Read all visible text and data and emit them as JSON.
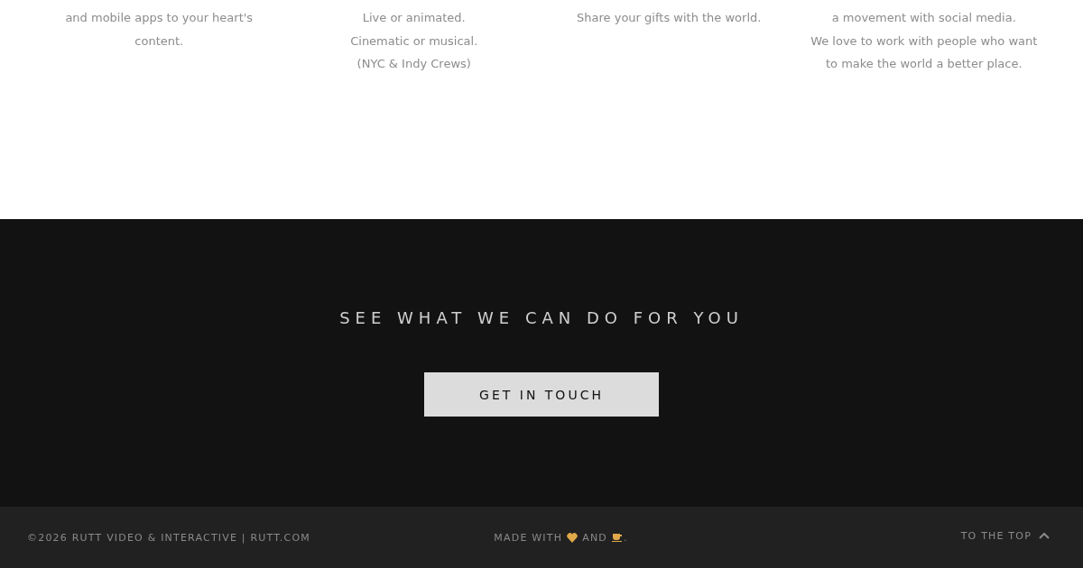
{
  "services": [
    {
      "lines": [
        "and mobile apps to your heart's",
        "content."
      ]
    },
    {
      "lines": [
        "Live or animated.",
        "Cinematic or musical.",
        "(NYC & Indy Crews)"
      ]
    },
    {
      "lines": [
        "Share your gifts with the world."
      ]
    },
    {
      "lines": [
        "a movement with social media.",
        "We love to work with people who want",
        "to make the world a better place."
      ]
    }
  ],
  "cta": {
    "heading": "SEE WHAT WE CAN DO FOR YOU",
    "button": "GET IN TOUCH"
  },
  "footer": {
    "copyright": "©2026 RUTT VIDEO & INTERACTIVE | RUTT.COM",
    "made_with": "MADE WITH",
    "and": "AND",
    "period": ".",
    "to_top": "TO THE TOP"
  }
}
